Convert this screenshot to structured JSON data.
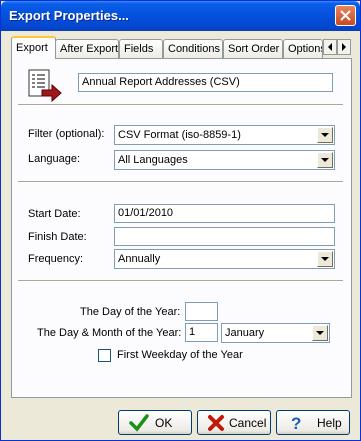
{
  "window": {
    "title": "Export Properties..."
  },
  "tabs": [
    {
      "label": "Export"
    },
    {
      "label": "After Export"
    },
    {
      "label": "Fields"
    },
    {
      "label": "Conditions"
    },
    {
      "label": "Sort Order"
    },
    {
      "label": "Options"
    }
  ],
  "export": {
    "name_value": "Annual Report Addresses (CSV)",
    "filter_label": "Filter (optional):",
    "filter_value": "CSV Format (iso-8859-1)",
    "language_label": "Language:",
    "language_value": "All Languages",
    "start_date_label": "Start Date:",
    "start_date_value": "01/01/2010",
    "finish_date_label": "Finish Date:",
    "finish_date_value": "",
    "frequency_label": "Frequency:",
    "frequency_value": "Annually",
    "day_of_year_label": "The Day of the Year:",
    "day_of_year_value": "",
    "day_month_label": "The Day & Month of the Year:",
    "day_value": "1",
    "month_value": "January",
    "first_weekday_label": "First Weekday of the Year",
    "first_weekday_checked": false
  },
  "buttons": {
    "ok": "OK",
    "cancel": "Cancel",
    "help": "Help"
  },
  "icons": {
    "export_icon": "export-document-icon",
    "ok_icon": "checkmark-icon",
    "cancel_icon": "x-icon",
    "help_icon": "question-mark-icon"
  }
}
